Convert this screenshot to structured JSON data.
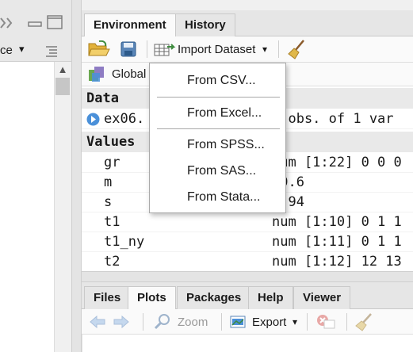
{
  "left_pane": {
    "partial_label": "ce",
    "dropdown_arrow": "▾"
  },
  "env_pane": {
    "tabs": [
      {
        "label": "Environment",
        "active": true
      },
      {
        "label": "History",
        "active": false
      }
    ],
    "toolbar": {
      "import_label": "Import Dataset",
      "import_arrow": "▾"
    },
    "scope_label": "Global"
  },
  "environment": {
    "data_header": "Data",
    "data_rows": [
      {
        "name": "ex06.",
        "value": "0 obs. of 1 var"
      }
    ],
    "values_header": "Values",
    "value_rows": [
      {
        "name": "gr",
        "value": "num [1:22] 0 0 0"
      },
      {
        "name": "m",
        "value": "40.6"
      },
      {
        "name": "s",
        "value": "5.94"
      },
      {
        "name": "t1",
        "value": "num [1:10] 0 1 1"
      },
      {
        "name": "t1_ny",
        "value": "num [1:11] 0 1 1"
      },
      {
        "name": "t2",
        "value": "num [1:12] 12 13"
      }
    ]
  },
  "import_menu": {
    "items": [
      {
        "label": "From CSV..."
      },
      {
        "label": "From Excel..."
      },
      {
        "label": "From SPSS..."
      },
      {
        "label": "From SAS..."
      },
      {
        "label": "From Stata..."
      }
    ]
  },
  "files_pane": {
    "tabs": [
      {
        "label": "Files",
        "active": false
      },
      {
        "label": "Plots",
        "active": true
      },
      {
        "label": "Packages",
        "active": false
      },
      {
        "label": "Help",
        "active": false
      },
      {
        "label": "Viewer",
        "active": false
      }
    ],
    "toolbar": {
      "zoom_label": "Zoom",
      "export_label": "Export",
      "export_arrow": "▾"
    }
  },
  "colors": {
    "accent_blue": "#4a90d9",
    "folder_yellow": "#e2b23a",
    "broom": "#c8a040",
    "delete_red": "#d9534f"
  }
}
